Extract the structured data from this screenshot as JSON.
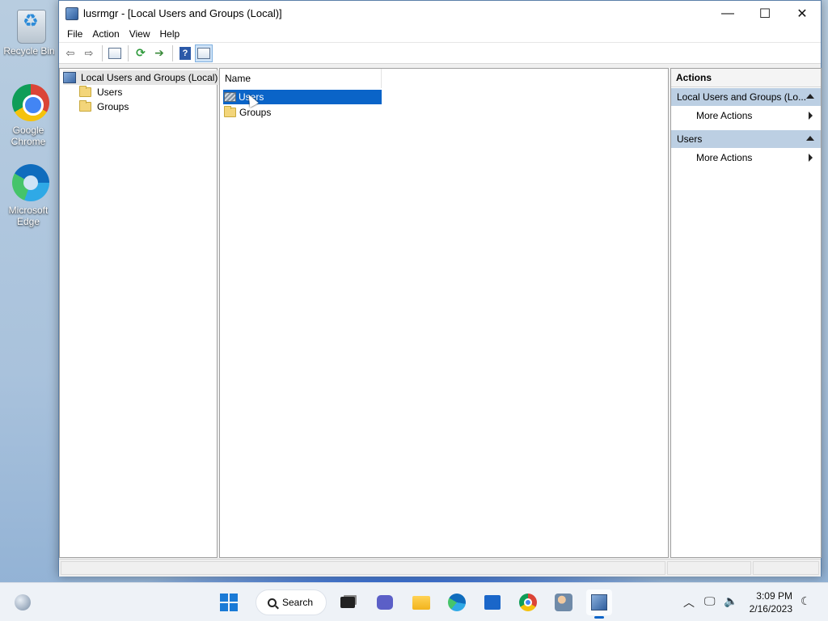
{
  "desktop": {
    "icons": [
      {
        "label": "Recycle Bin",
        "icon": "recycle-bin-icon"
      },
      {
        "label": "Google Chrome",
        "icon": "chrome-icon"
      },
      {
        "label": "Microsoft Edge",
        "icon": "edge-icon"
      }
    ]
  },
  "window": {
    "title": "lusrmgr - [Local Users and Groups (Local)]",
    "controls": {
      "minimize": "—",
      "maximize": "☐",
      "close": "✕"
    }
  },
  "menubar": {
    "items": [
      "File",
      "Action",
      "View",
      "Help"
    ]
  },
  "toolbar": {
    "buttons": [
      "back-icon",
      "forward-icon",
      "show-hide-console-tree-icon",
      "refresh-icon",
      "export-list-icon",
      "help-icon",
      "show-hide-action-pane-icon"
    ]
  },
  "tree": {
    "root": "Local Users and Groups (Local)",
    "children": [
      "Users",
      "Groups"
    ]
  },
  "list": {
    "column_header": "Name",
    "rows": [
      {
        "name": "Users",
        "selected": true
      },
      {
        "name": "Groups",
        "selected": false
      }
    ]
  },
  "actions": {
    "header": "Actions",
    "sections": [
      {
        "title": "Local Users and Groups (Lo...",
        "items": [
          "More Actions"
        ]
      },
      {
        "title": "Users",
        "items": [
          "More Actions"
        ]
      }
    ]
  },
  "taskbar": {
    "search_label": "Search",
    "time": "3:09 PM",
    "date": "2/16/2023",
    "accent": "#0a64c8"
  }
}
